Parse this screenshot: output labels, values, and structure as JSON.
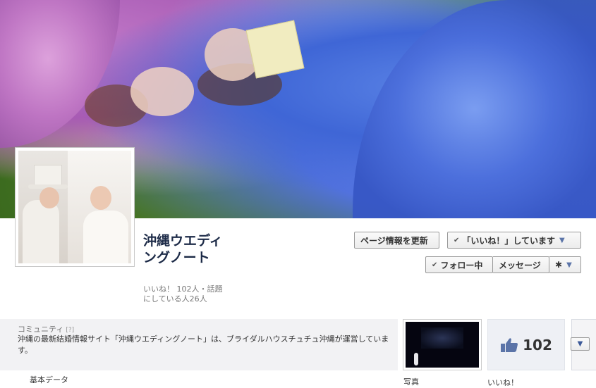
{
  "page": {
    "name": "沖縄ウエディングノート",
    "likes_line": "いいね！ 102人・話題にしている人26人"
  },
  "buttons": {
    "update_info": "ページ情報を更新",
    "liked": "「いいね！」しています",
    "follow": "フォロー中",
    "message": "メッセージ"
  },
  "icons": {
    "check": "✔",
    "caret": "▼",
    "gear": "✱",
    "thumbs_up": "like-thumb-icon"
  },
  "about": {
    "title": "コミュニティ",
    "help": "[?]",
    "text": "沖縄の最新結婚情報サイト「沖縄ウエディングノート」は、ブライダルハウスチュチュ沖縄が運営しています。",
    "basic_data_label": "基本データ"
  },
  "tiles": {
    "photo_label": "写真",
    "like_count": "102",
    "like_label": "いいね！"
  },
  "colors": {
    "name_text": "#1c2a47",
    "fb_blue": "#3b5998",
    "thumb": "#5b74a8"
  }
}
